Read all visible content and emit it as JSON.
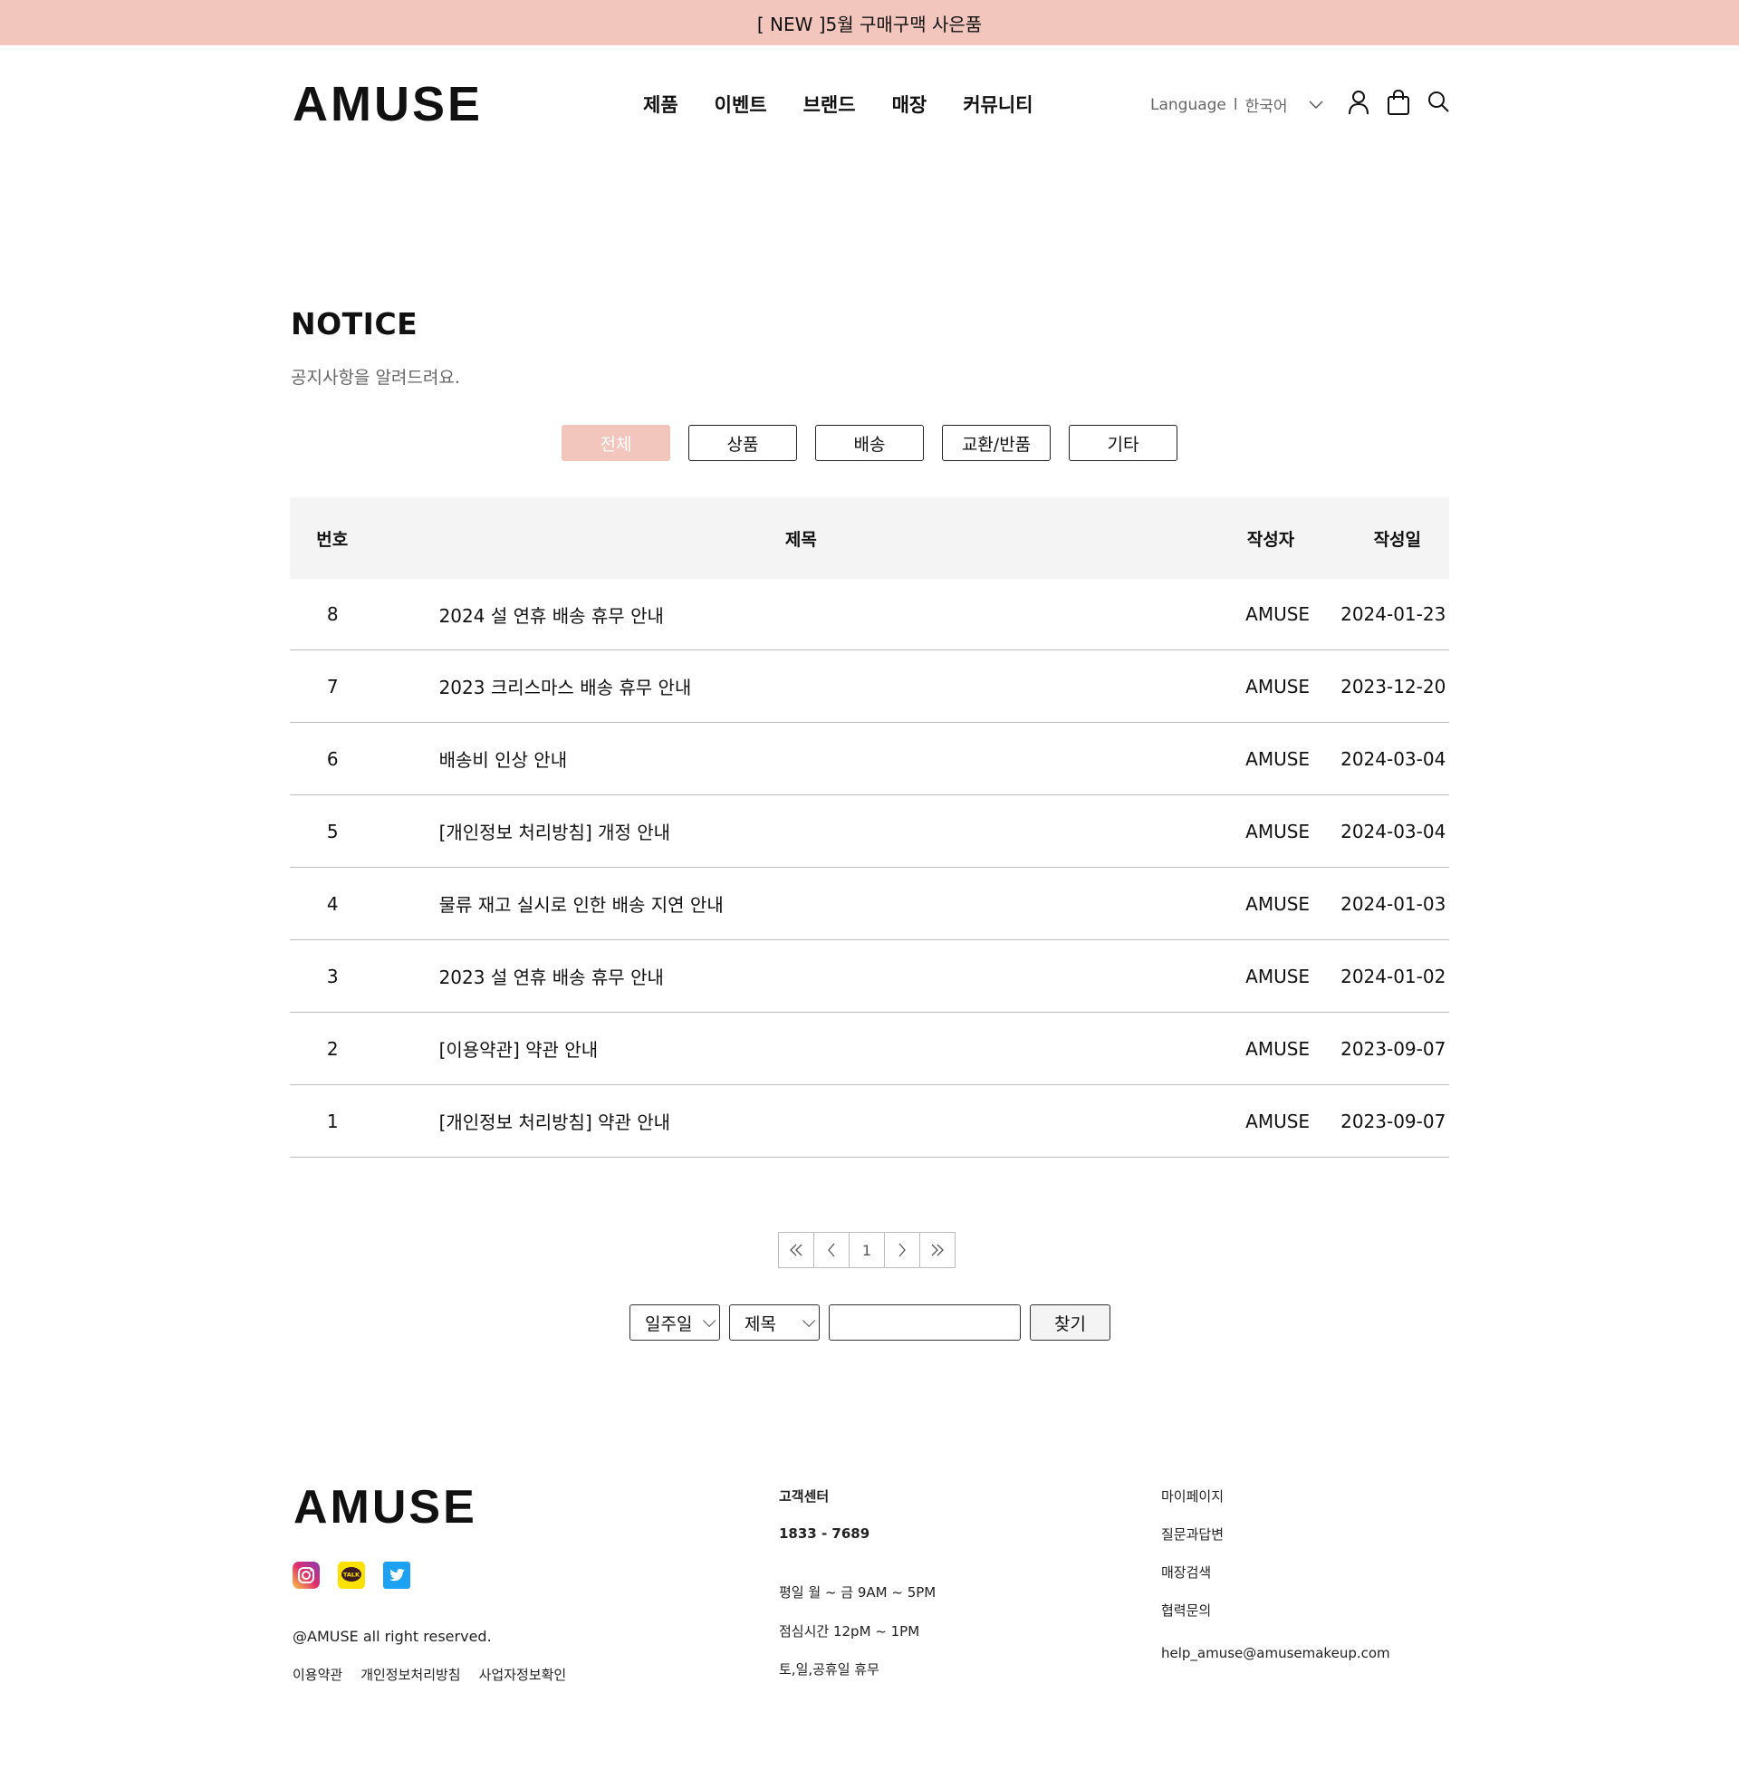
{
  "topbar": {
    "announcement": "[ NEW ]5월 구매구맥 사은품"
  },
  "header": {
    "logo": "AMUSE",
    "nav": [
      "제품",
      "이벤트",
      "브랜드",
      "매장",
      "커뮤니티"
    ],
    "language_label": "Language",
    "language_sep": "l",
    "language_value": "한국어",
    "icons": [
      "user-icon",
      "shopping-bag-icon",
      "search-icon"
    ]
  },
  "page": {
    "title": "NOTICE",
    "subtitle": "공지사항을 알려드려요."
  },
  "tabs": [
    {
      "label": "전체",
      "active": true
    },
    {
      "label": "상품",
      "active": false
    },
    {
      "label": "배송",
      "active": false
    },
    {
      "label": "교환/반품",
      "active": false
    },
    {
      "label": "기타",
      "active": false
    }
  ],
  "table": {
    "headers": {
      "no": "번호",
      "title": "제목",
      "author": "작성자",
      "date": "작성일"
    },
    "rows": [
      {
        "no": "8",
        "title": "2024 설 연휴 배송 휴무 안내",
        "author": "AMUSE",
        "date": "2024-01-23"
      },
      {
        "no": "7",
        "title": "2023 크리스마스 배송 휴무 안내",
        "author": "AMUSE",
        "date": "2023-12-20"
      },
      {
        "no": "6",
        "title": "배송비 인상 안내",
        "author": "AMUSE",
        "date": "2024-03-04"
      },
      {
        "no": "5",
        "title": "[개인정보 처리방침] 개정 안내",
        "author": "AMUSE",
        "date": "2024-03-04"
      },
      {
        "no": "4",
        "title": "물류 재고 실시로 인한 배송 지연 안내",
        "author": "AMUSE",
        "date": "2024-01-03"
      },
      {
        "no": "3",
        "title": "2023 설 연휴 배송 휴무 안내",
        "author": "AMUSE",
        "date": "2024-01-02"
      },
      {
        "no": "2",
        "title": "[이용약관] 약관 안내",
        "author": "AMUSE",
        "date": "2023-09-07"
      },
      {
        "no": "1",
        "title": "[개인정보 처리방침] 약관 안내",
        "author": "AMUSE",
        "date": "2023-09-07"
      }
    ]
  },
  "pagination": {
    "first": "«",
    "prev": "‹",
    "page": "1",
    "next": "›",
    "last": "»"
  },
  "search": {
    "period": "일주일",
    "field": "제목",
    "query": "",
    "button": "찾기"
  },
  "footer": {
    "logo": "AMUSE",
    "socials": [
      "instagram-icon",
      "kakaotalk-icon",
      "twitter-icon"
    ],
    "kakao_text": "TALK",
    "copyright": "@AMUSE all right reserved.",
    "links": [
      "이용약관",
      "개인정보처리방침",
      "사업자정보확인"
    ],
    "cs_title": "고객센터",
    "cs_phone": "1833 - 7689",
    "cs_hours": "평일 월 ~ 금  9AM ~ 5PM",
    "cs_lunch": "점심시간  12pM ~ 1PM",
    "cs_holiday": "토,일,공휴일 휴무",
    "menu": [
      "마이페이지",
      "질문과답변",
      "매장검색",
      "협력문의"
    ],
    "email": "help_amuse@amusemakeup.com"
  },
  "colors": {
    "accent": "#f2c6bd",
    "header_bg": "#f4f4f4",
    "muted": "#666666"
  }
}
